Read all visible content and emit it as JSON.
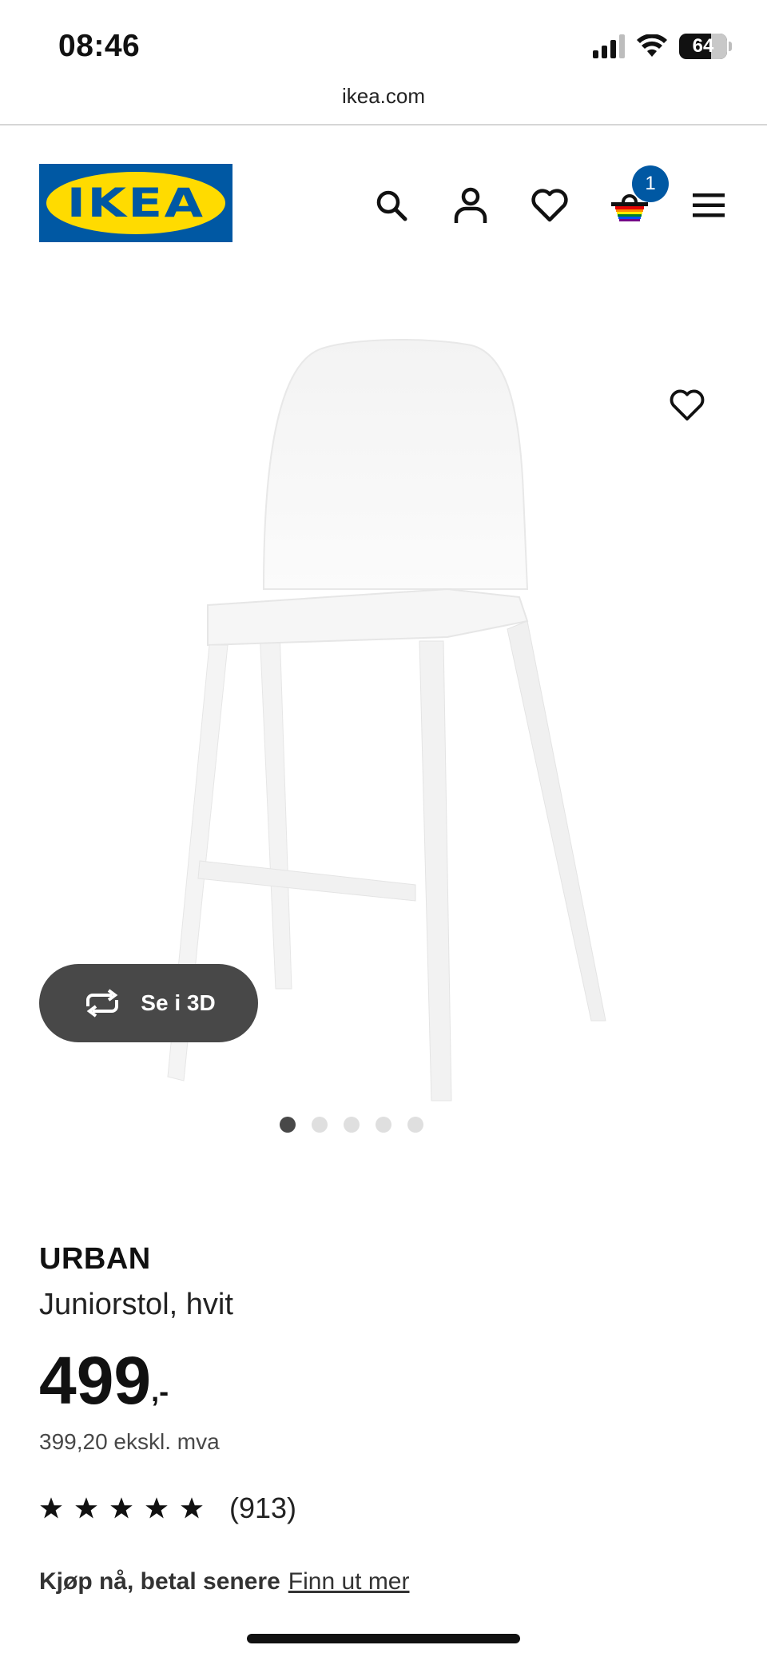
{
  "status_bar": {
    "time": "08:46",
    "battery_level": "64"
  },
  "browser": {
    "url": "ikea.com"
  },
  "header": {
    "logo_text": "IKEA",
    "cart_count": "1",
    "icons": [
      "search-icon",
      "account-icon",
      "heart-icon",
      "cart-icon",
      "menu-icon"
    ]
  },
  "media": {
    "view_3d_label": "Se i 3D",
    "image_count": 5,
    "active_image": 1
  },
  "product": {
    "name": "URBAN",
    "description": "Juniorstol, hvit",
    "price": "499",
    "price_suffix": ",-",
    "price_excl_vat": "399,20 ekskl. mva",
    "rating_stars": 5,
    "rating_count": "(913)"
  },
  "financing": {
    "label": "Kjøp nå, betal senere",
    "link": "Finn ut mer"
  },
  "colors": {
    "brand_blue": "#0058a3",
    "brand_yellow": "#ffdb00",
    "dark_button": "#484848"
  }
}
